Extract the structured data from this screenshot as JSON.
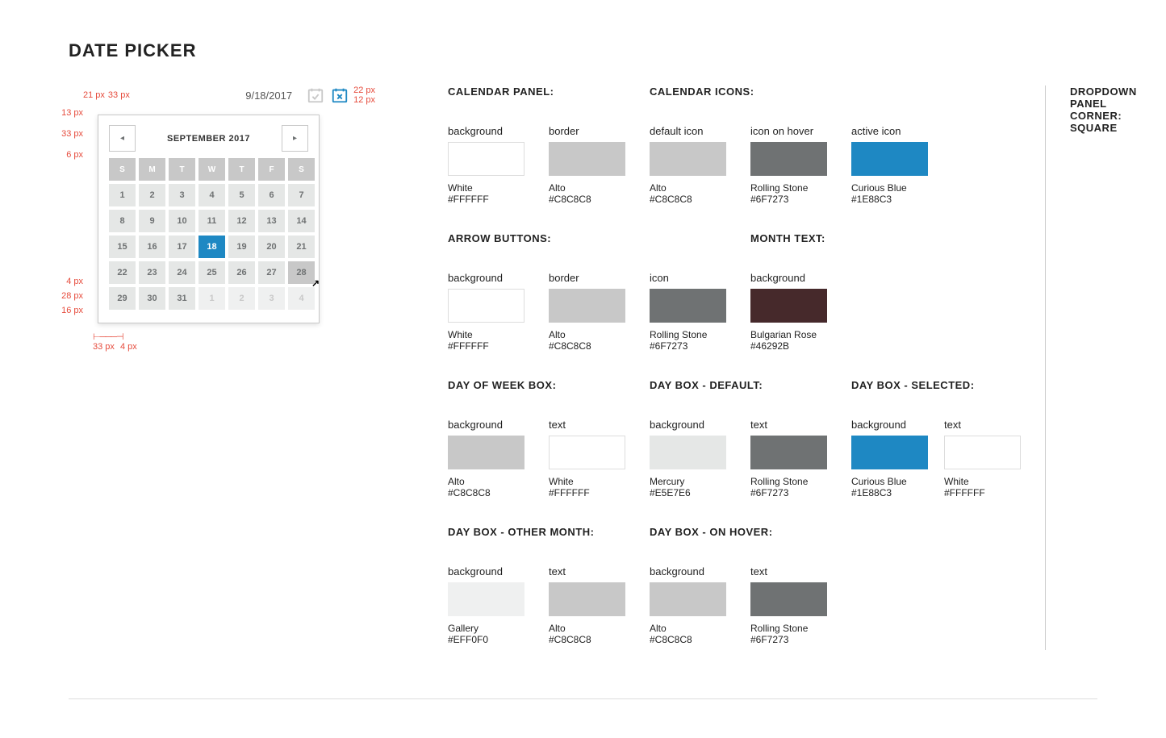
{
  "title": "DATE PICKER",
  "annotations": {
    "header_left1": "21 px",
    "header_left2": "33 px",
    "icon_h": "22 px",
    "icon_gap": "12 px",
    "panel_top_gap": "13 px",
    "arrow_h": "33 px",
    "arrow_below": "6 px",
    "row_gap": "4 px",
    "row_h": "28 px",
    "panel_bottom": "16 px",
    "col_w": "33 px",
    "col_gap": "4 px"
  },
  "header_date": "9/18/2017",
  "month_label": "SEPTEMBER 2017",
  "dow": [
    "S",
    "M",
    "T",
    "W",
    "T",
    "F",
    "S"
  ],
  "weeks": [
    [
      {
        "n": 1
      },
      {
        "n": 2
      },
      {
        "n": 3
      },
      {
        "n": 4
      },
      {
        "n": 5
      },
      {
        "n": 6
      },
      {
        "n": 7
      }
    ],
    [
      {
        "n": 8
      },
      {
        "n": 9
      },
      {
        "n": 10
      },
      {
        "n": 11
      },
      {
        "n": 12
      },
      {
        "n": 13
      },
      {
        "n": 14
      }
    ],
    [
      {
        "n": 15
      },
      {
        "n": 16
      },
      {
        "n": 17
      },
      {
        "n": 18,
        "sel": true
      },
      {
        "n": 19
      },
      {
        "n": 20
      },
      {
        "n": 21
      }
    ],
    [
      {
        "n": 22
      },
      {
        "n": 23
      },
      {
        "n": 24
      },
      {
        "n": 25
      },
      {
        "n": 26
      },
      {
        "n": 27
      },
      {
        "n": 28,
        "hover": true
      }
    ],
    [
      {
        "n": 29
      },
      {
        "n": 30
      },
      {
        "n": 31
      },
      {
        "n": 1,
        "other": true
      },
      {
        "n": 2,
        "other": true
      },
      {
        "n": 3,
        "other": true
      },
      {
        "n": 4,
        "other": true
      }
    ]
  ],
  "sections": [
    {
      "head": "CALENDAR PANEL:",
      "items": [
        {
          "lbl": "background",
          "sw": "#FFFFFF",
          "bordered": true,
          "name": "White",
          "hex": "#FFFFFF"
        },
        {
          "lbl": "border",
          "sw": "#C8C8C8",
          "name": "Alto",
          "hex": "#C8C8C8"
        }
      ]
    },
    {
      "head": "CALENDAR ICONS:",
      "items": [
        {
          "lbl": "default icon",
          "sw": "#C8C8C8",
          "name": "Alto",
          "hex": "#C8C8C8"
        },
        {
          "lbl": "icon on hover",
          "sw": "#6F7273",
          "name": "Rolling Stone",
          "hex": "#6F7273"
        },
        {
          "lbl": "active icon",
          "sw": "#1E88C3",
          "name": "Curious Blue",
          "hex": "#1E88C3"
        }
      ]
    },
    {
      "head": "ARROW BUTTONS:",
      "items": [
        {
          "lbl": "background",
          "sw": "#FFFFFF",
          "bordered": true,
          "name": "White",
          "hex": "#FFFFFF"
        },
        {
          "lbl": "border",
          "sw": "#C8C8C8",
          "name": "Alto",
          "hex": "#C8C8C8"
        },
        {
          "lbl": "icon",
          "sw": "#6F7273",
          "name": "Rolling Stone",
          "hex": "#6F7273"
        }
      ]
    },
    {
      "head": "MONTH TEXT:",
      "items": [
        {
          "lbl": "background",
          "sw": "#46292B",
          "name": "Bulgarian Rose",
          "hex": "#46292B"
        }
      ]
    },
    {
      "head": "DAY OF WEEK BOX:",
      "items": [
        {
          "lbl": "background",
          "sw": "#C8C8C8",
          "name": "Alto",
          "hex": "#C8C8C8"
        },
        {
          "lbl": "text",
          "sw": "#FFFFFF",
          "bordered": true,
          "name": "White",
          "hex": "#FFFFFF"
        }
      ]
    },
    {
      "head": "DAY BOX - DEFAULT:",
      "items": [
        {
          "lbl": "background",
          "sw": "#E5E7E6",
          "name": "Mercury",
          "hex": "#E5E7E6"
        },
        {
          "lbl": "text",
          "sw": "#6F7273",
          "name": "Rolling Stone",
          "hex": "#6F7273"
        }
      ]
    },
    {
      "head": "DAY BOX - SELECTED:",
      "items": [
        {
          "lbl": "background",
          "sw": "#1E88C3",
          "name": "Curious Blue",
          "hex": "#1E88C3"
        },
        {
          "lbl": "text",
          "sw": "#FFFFFF",
          "bordered": true,
          "name": "White",
          "hex": "#FFFFFF"
        }
      ]
    },
    {
      "head": "DAY BOX - OTHER MONTH:",
      "items": [
        {
          "lbl": "background",
          "sw": "#EFF0F0",
          "name": "Gallery",
          "hex": "#EFF0F0"
        },
        {
          "lbl": "text",
          "sw": "#C8C8C8",
          "name": "Alto",
          "hex": "#C8C8C8"
        }
      ]
    },
    {
      "head": "DAY BOX - ON HOVER:",
      "items": [
        {
          "lbl": "background",
          "sw": "#C8C8C8",
          "name": "Alto",
          "hex": "#C8C8C8"
        },
        {
          "lbl": "text",
          "sw": "#6F7273",
          "name": "Rolling Stone",
          "hex": "#6F7273"
        }
      ]
    }
  ],
  "side1": "DROPDOWN PANEL",
  "side2": "CORNER:  SQUARE"
}
